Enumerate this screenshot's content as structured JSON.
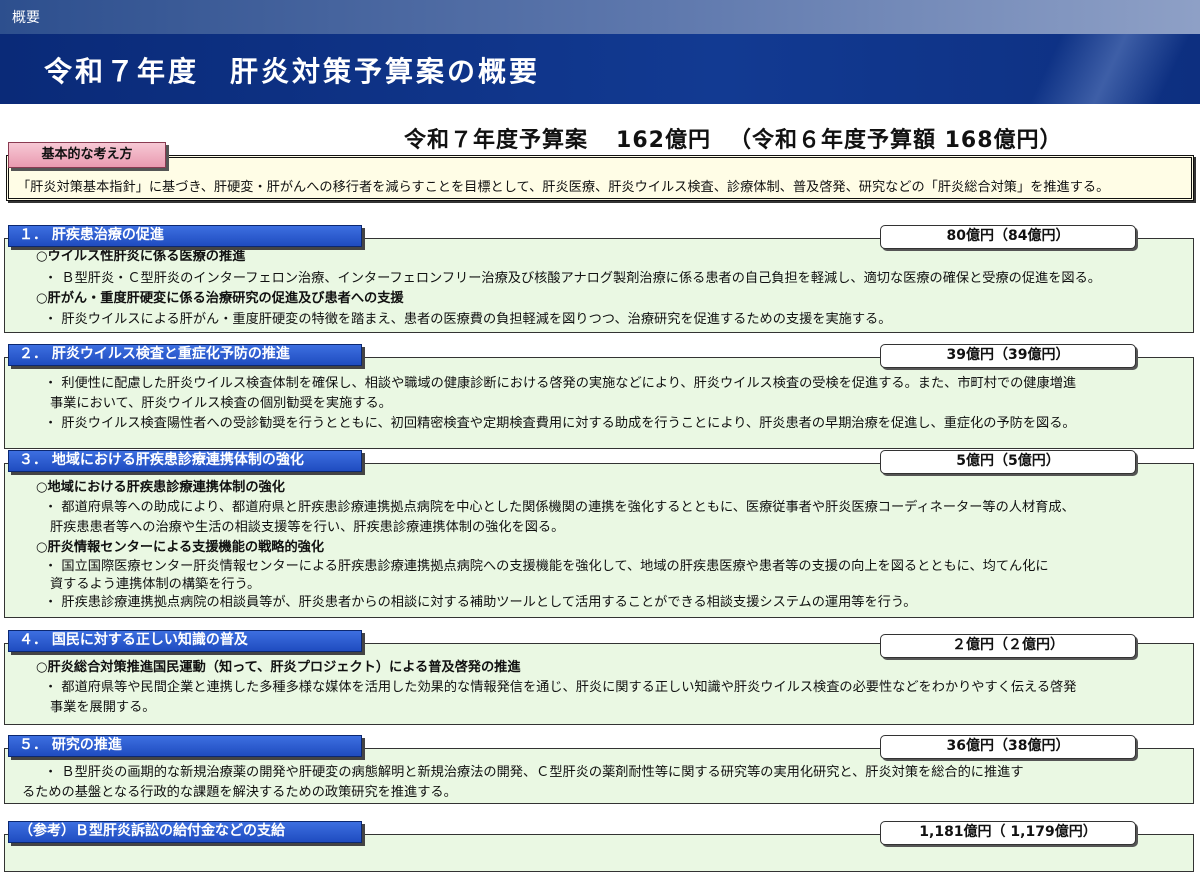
{
  "header": {
    "breadcrumb": "概要",
    "title": "令和７年度　肝炎対策予算案の概要"
  },
  "budget": {
    "label": "令和７年度予算案",
    "amount": "162億円",
    "prev": "（令和６年度予算額  168億円）"
  },
  "basic": {
    "label": "基本的な考え方",
    "text": "「肝炎対策基本指針」に基づき、肝硬変・肝がんへの移行者を減らすことを目標として、肝炎医療、肝炎ウイルス検査、診療体制、普及啓発、研究などの「肝炎総合対策」を推進する。"
  },
  "sections": [
    {
      "title": "１．  肝疾患治療の促進",
      "amount": "80億円（84億円）",
      "lines": [
        "○ウイルス性肝炎に係る医療の推進",
        "・ Ｂ型肝炎・Ｃ型肝炎のインターフェロン治療、インターフェロンフリー治療及び核酸アナログ製剤治療に係る患者の自己負担を軽減し、適切な医療の確保と受療の促進を図る。",
        "○肝がん・重度肝硬変に係る治療研究の促進及び患者への支援",
        "・ 肝炎ウイルスによる肝がん・重度肝硬変の特徴を踏まえ、患者の医療費の負担軽減を図りつつ、治療研究を促進するための支援を実施する。"
      ]
    },
    {
      "title": "２．  肝炎ウイルス検査と重症化予防の推進",
      "amount": "39億円（39億円）",
      "lines": [
        "・ 利便性に配慮した肝炎ウイルス検査体制を確保し、相談や職域の健康診断における啓発の実施などにより、肝炎ウイルス検査の受検を促進する。また、市町村での健康増進",
        "事業において、肝炎ウイルス検査の個別勧奨を実施する。",
        "・ 肝炎ウイルス検査陽性者への受診勧奨を行うとともに、初回精密検査や定期検査費用に対する助成を行うことにより、肝炎患者の早期治療を促進し、重症化の予防を図る。"
      ]
    },
    {
      "title": "３．  地域における肝疾患診療連携体制の強化",
      "amount": "5億円（5億円）",
      "lines": [
        "○地域における肝疾患診療連携体制の強化",
        "・ 都道府県等への助成により、都道府県と肝疾患診療連携拠点病院を中心とした関係機関の連携を強化するとともに、医療従事者や肝炎医療コーディネーター等の人材育成、",
        "肝疾患患者等への治療や生活の相談支援等を行い、肝疾患診療連携体制の強化を図る。",
        "○肝炎情報センターによる支援機能の戦略的強化",
        "・ 国立国際医療センター肝炎情報センターによる肝疾患診療連携拠点病院への支援機能を強化して、地域の肝疾患医療や患者等の支援の向上を図るとともに、均てん化に",
        "資するよう連携体制の構築を行う。",
        "・ 肝疾患診療連携拠点病院の相談員等が、肝炎患者からの相談に対する補助ツールとして活用することができる相談支援システムの運用等を行う。"
      ]
    },
    {
      "title": "４．  国民に対する正しい知識の普及",
      "amount": "２億円（２億円）",
      "lines": [
        "○肝炎総合対策推進国民運動（知って、肝炎プロジェクト）による普及啓発の推進",
        "・ 都道府県等や民間企業と連携した多種多様な媒体を活用した効果的な情報発信を通じ、肝炎に関する正しい知識や肝炎ウイルス検査の必要性などをわかりやすく伝える啓発",
        "事業を展開する。"
      ]
    },
    {
      "title": "５．  研究の推進",
      "amount": "36億円（38億円）",
      "lines": [
        "・ Ｂ型肝炎の画期的な新規治療薬の開発や肝硬変の病態解明と新規治療法の開発、Ｃ型肝炎の薬剤耐性等に関する研究等の実用化研究と、肝炎対策を総合的に推進す",
        "るための基盤となる行政的な課題を解決するための政策研究を推進する。"
      ]
    },
    {
      "title": "（参考）Ｂ型肝炎訴訟の給付金などの支給",
      "amount": "1,181億円（ 1,179億円）",
      "lines": []
    }
  ]
}
